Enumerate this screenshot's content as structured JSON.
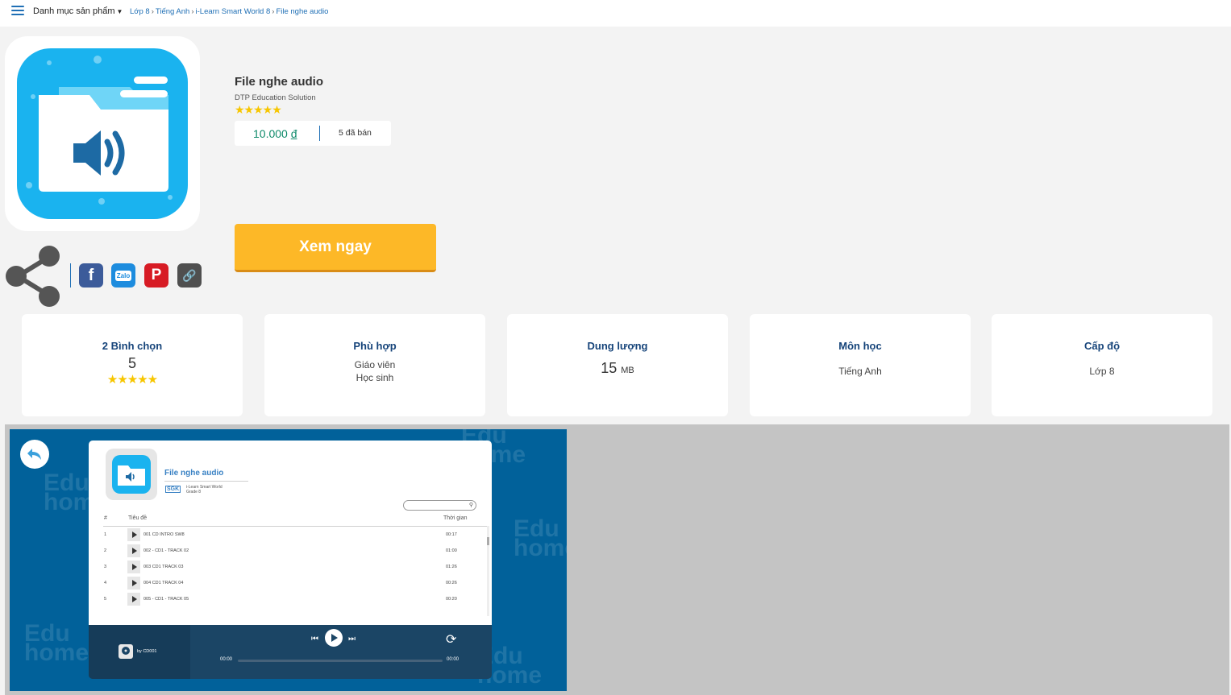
{
  "topbar": {
    "catalog_label": "Danh mục sản phẩm",
    "breadcrumb": [
      "Lớp 8",
      "Tiếng Anh",
      "i-Learn Smart World 8",
      "File nghe audio"
    ]
  },
  "product": {
    "title": "File nghe audio",
    "publisher": "DTP Education Solution",
    "rating_stars": 5,
    "price": "10.000",
    "currency": "đ",
    "sold": "5 đã bán",
    "view_button": "Xem ngay"
  },
  "social": [
    "facebook-icon",
    "zalo-icon",
    "pinterest-icon",
    "link-icon"
  ],
  "social_zalo_text": "Zalo",
  "stats": {
    "votes_title": "2 Bình chọn",
    "votes_value": "5",
    "suitable_title": "Phù hợp",
    "suitable_values": [
      "Giáo viên",
      "Học sinh"
    ],
    "size_title": "Dung lượng",
    "size_value": "15",
    "size_unit": "MB",
    "subject_title": "Môn học",
    "subject_value": "Tiếng Anh",
    "level_title": "Cấp độ",
    "level_value": "Lớp 8"
  },
  "player": {
    "title": "File nghe audio",
    "badge": "SGK",
    "book_line1": "i-Learn Smart World",
    "book_line2": "Grade 8",
    "col_num": "#",
    "col_title": "Tiêu đề",
    "col_time": "Thời gian",
    "tracks": [
      {
        "num": "1",
        "title": "001   CD INTRO SW8",
        "time": "00:17"
      },
      {
        "num": "2",
        "title": "002 - CD1 - TRACK 02",
        "time": "01:00"
      },
      {
        "num": "3",
        "title": "003   CD1   TRACK 03",
        "time": "01:26"
      },
      {
        "num": "4",
        "title": "004   CD1   TRACK 04",
        "time": "00:26"
      },
      {
        "num": "5",
        "title": "005 - CD1 - TRACK 05",
        "time": "00:20"
      }
    ],
    "by": "by CD001",
    "time_start": "00:00",
    "time_end": "00:00",
    "watermark": [
      "Edu",
      "home"
    ]
  },
  "colors": {
    "accent": "#1f6fb5",
    "button": "#fdb827",
    "star": "#f7c600",
    "player_bg": "#01619a",
    "icon_bg": "#1ab3ef"
  }
}
